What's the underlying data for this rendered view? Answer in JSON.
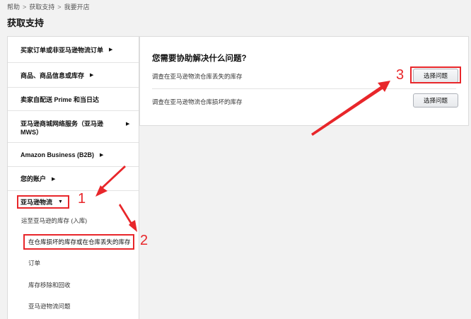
{
  "breadcrumb": {
    "items": [
      "帮助",
      "获取支持",
      "我要开店"
    ],
    "separator": ">"
  },
  "page_title": "获取支持",
  "sidebar": {
    "items": [
      {
        "label": "买家订单或非亚马逊物流订单",
        "caret": "▶"
      },
      {
        "label": "商品、商品信息或库存",
        "caret": "▶"
      },
      {
        "label": "卖家自配送 Prime 和当日达",
        "caret": "▶"
      },
      {
        "label": "亚马逊商城网络服务（亚马逊 MWS）",
        "caret": "▶"
      },
      {
        "label": "Amazon Business (B2B)",
        "caret": "▶"
      },
      {
        "label": "您的账户",
        "caret": "▶"
      },
      {
        "label": "亚马逊物流",
        "caret": "▼"
      }
    ],
    "subitems": [
      "运至亚马逊的库存 (入库)",
      "在仓库损坏的库存或在仓库丢失的库存",
      "订单",
      "库存移除和回收",
      "亚马逊物流问题"
    ]
  },
  "panel": {
    "title": "您需要协助解决什么问题?",
    "questions": [
      {
        "text": "调查在亚马逊物流仓库丢失的库存",
        "button": "选择问题"
      },
      {
        "text": "调查在亚马逊物流仓库损坏的库存",
        "button": "选择问题"
      }
    ]
  },
  "annotations": {
    "numbers": [
      "1",
      "2",
      "3"
    ],
    "color": "#e8262a"
  }
}
